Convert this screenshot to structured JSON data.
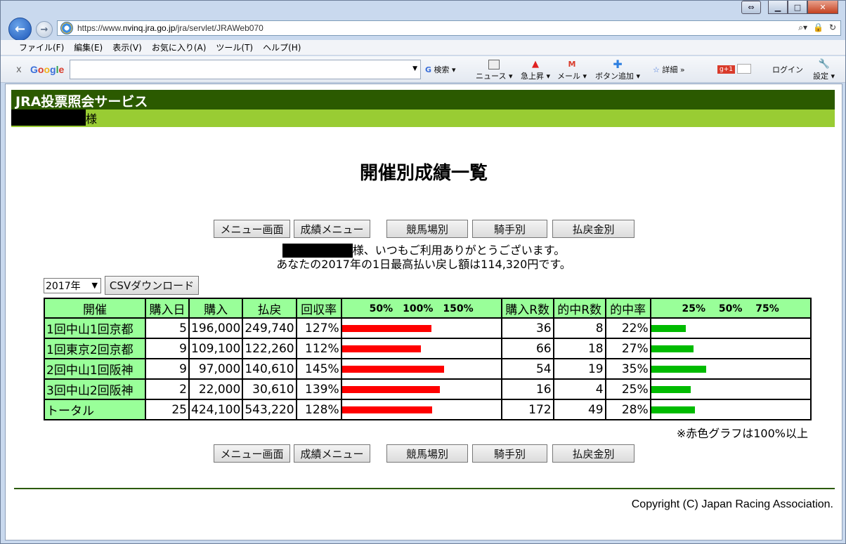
{
  "browser": {
    "url_prefix": "https://www.",
    "url_host": "nvinq.jra.go.jp",
    "url_path": "/jra/servlet/JRAWeb070",
    "menu": [
      "ファイル(F)",
      "編集(E)",
      "表示(V)",
      "お気に入り(A)",
      "ツール(T)",
      "ヘルプ(H)"
    ],
    "toolbar": {
      "close": "x",
      "google_letters": [
        "G",
        "o",
        "o",
        "g",
        "l",
        "e"
      ],
      "search_label": "検索",
      "news": "ニュース",
      "rising": "急上昇",
      "mail": "メール",
      "add_button": "ボタン追加",
      "details": "詳細 »",
      "login": "ログイン",
      "settings": "設定"
    }
  },
  "site": {
    "header": "JRA投票照会サービス",
    "sama": "様"
  },
  "page": {
    "title": "開催別成績一覧",
    "nav_buttons": [
      "メニュー画面",
      "成績メニュー",
      "競馬場別",
      "騎手別",
      "払戻金別"
    ],
    "welcome_suffix": "様、いつもご利用ありがとうございます。",
    "welcome_line2": "あなたの2017年の1日最高払い戻し額は114,320円です。",
    "year_selected": "2017年",
    "csv_button": "CSVダウンロード",
    "note": "※赤色グラフは100%以上",
    "copyright": "Copyright (C) Japan Racing Association."
  },
  "table": {
    "headers": [
      "開催",
      "購入日",
      "購入",
      "払戻",
      "回収率",
      "50%　100%　150%",
      "購入R数",
      "的中R数",
      "的中率",
      "25%　 50%　 75%"
    ],
    "rows": [
      {
        "name": "1回中山1回京都",
        "days": "5",
        "buy": "196,000",
        "payout": "249,740",
        "rate": "127%",
        "rate_value": 127,
        "races": "36",
        "hits": "8",
        "hit_rate": "22%",
        "hit_value": 22
      },
      {
        "name": "1回東京2回京都",
        "days": "9",
        "buy": "109,100",
        "payout": "122,260",
        "rate": "112%",
        "rate_value": 112,
        "races": "66",
        "hits": "18",
        "hit_rate": "27%",
        "hit_value": 27
      },
      {
        "name": "2回中山1回阪神",
        "days": "9",
        "buy": "97,000",
        "payout": "140,610",
        "rate": "145%",
        "rate_value": 145,
        "races": "54",
        "hits": "19",
        "hit_rate": "35%",
        "hit_value": 35
      },
      {
        "name": "3回中山2回阪神",
        "days": "2",
        "buy": "22,000",
        "payout": "30,610",
        "rate": "139%",
        "rate_value": 139,
        "races": "16",
        "hits": "4",
        "hit_rate": "25%",
        "hit_value": 25
      },
      {
        "name": "トータル",
        "days": "25",
        "buy": "424,100",
        "payout": "543,220",
        "rate": "128%",
        "rate_value": 128,
        "races": "172",
        "hits": "49",
        "hit_rate": "28%",
        "hit_value": 28
      }
    ]
  },
  "colors": {
    "header_green": "#2b5a00",
    "sub_green": "#99cc33",
    "table_green": "#99ff99",
    "bar_red": "#ff0000",
    "bar_green": "#00bb00"
  }
}
